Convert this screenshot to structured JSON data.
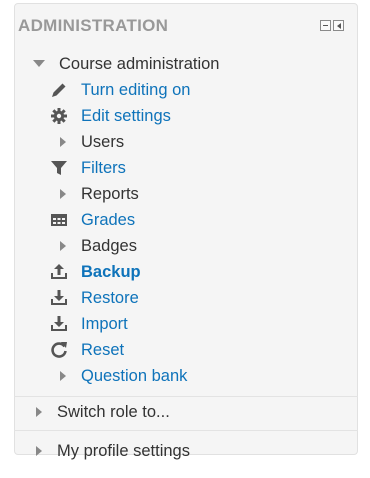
{
  "block": {
    "title": "ADMINISTRATION",
    "controls": [
      "minimize-icon",
      "dock-icon"
    ]
  },
  "course_admin": {
    "label": "Course administration",
    "items": [
      {
        "label": "Turn editing on",
        "icon": "pencil-icon",
        "style": "link"
      },
      {
        "label": "Edit settings",
        "icon": "gear-icon",
        "style": "link"
      },
      {
        "label": "Users",
        "icon": "expand-triangle-icon",
        "style": "plain"
      },
      {
        "label": "Filters",
        "icon": "filter-icon",
        "style": "link"
      },
      {
        "label": "Reports",
        "icon": "expand-triangle-icon",
        "style": "plain"
      },
      {
        "label": "Grades",
        "icon": "grades-table-icon",
        "style": "link"
      },
      {
        "label": "Badges",
        "icon": "expand-triangle-icon",
        "style": "plain"
      },
      {
        "label": "Backup",
        "icon": "upload-icon",
        "style": "link-bold"
      },
      {
        "label": "Restore",
        "icon": "download-icon",
        "style": "link"
      },
      {
        "label": "Import",
        "icon": "download-icon",
        "style": "link"
      },
      {
        "label": "Reset",
        "icon": "refresh-icon",
        "style": "link"
      },
      {
        "label": "Question bank",
        "icon": "expand-triangle-icon",
        "style": "link"
      }
    ]
  },
  "switch_role": {
    "label": "Switch role to..."
  },
  "profile": {
    "label": "My profile settings"
  },
  "colors": {
    "link": "#0e73ba",
    "text": "#333333",
    "title": "#999999",
    "panel": "#f5f5f5"
  }
}
